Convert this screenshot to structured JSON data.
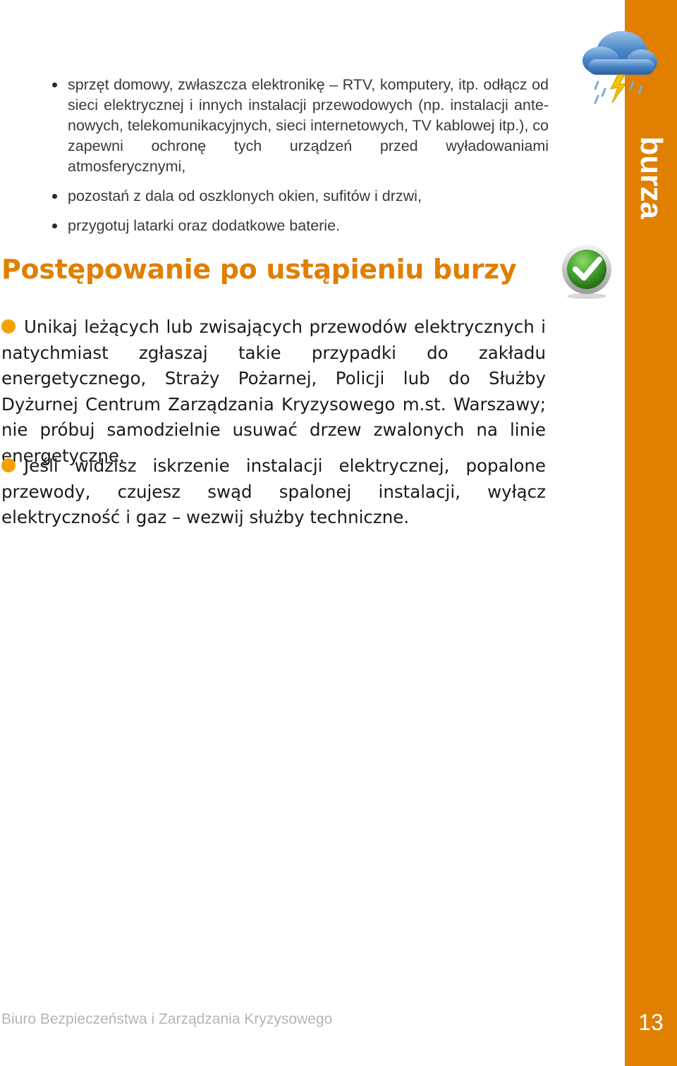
{
  "side_label": "burza",
  "page_number": "13",
  "bullets_top": [
    "sprzęt domowy, zwłaszcza elektronikę – RTV, komputery, itp. odłącz od sieci elektrycznej i innych instalacji przewodowych (np. instalacji ante­nowych, telekomunikacyjnych, sieci internetowych, TV kablowej itp.), co zapewni ochronę tych urządzeń przed wyładowaniami atmosferycznymi,",
    "pozostań z dala od oszklonych okien, sufitów i drzwi,",
    "przygotuj latarki oraz dodatkowe baterie."
  ],
  "section_title": "Postępowanie po ustąpieniu burzy",
  "paragraphs": [
    "Unikaj leżących lub zwisających przewodów elektrycznych i natychmiast zgłaszaj takie przypadki do zakładu energetyczne­go, Straży Pożarnej, Policji lub do Służby Dyżurnej Centrum Za­rządzania Kryzysowego m.st. Warszawy; nie próbuj samodzielnie usuwać drzew zwalonych na linie energetyczne.",
    "Jeśli widzisz iskrzenie instalacji elektrycznej, popalone przewo­dy, czujesz swąd spalonej instalacji, wyłącz elektryczność i gaz – wezwij służby techniczne."
  ],
  "footer": "Biuro Bezpieczeństwa i Zarządzania Kryzysowego",
  "icons": {
    "top_right": "storm-cloud-icon",
    "section": "checkmark-icon"
  },
  "colors": {
    "accent": "#e07f00",
    "bullet_orange": "#f6a000",
    "footer_gray": "#b5b5b5"
  }
}
